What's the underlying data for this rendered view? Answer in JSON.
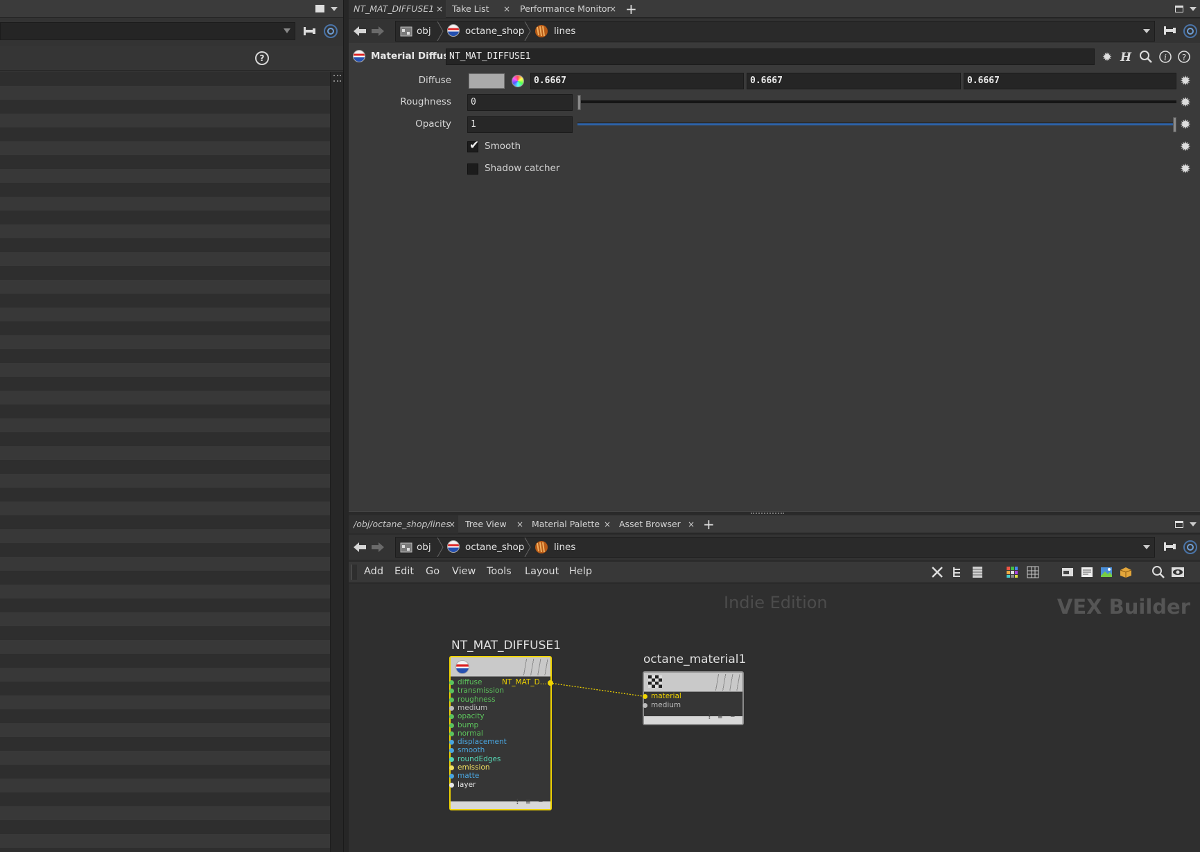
{
  "left_pane": {
    "help_label": "?"
  },
  "top_tabs": [
    {
      "label": "NT_MAT_DIFFUSE1",
      "active": true
    },
    {
      "label": "Take List",
      "active": false
    },
    {
      "label": "Performance Monitor",
      "active": false
    }
  ],
  "close_glyph": "×",
  "add_tab_glyph": "+",
  "top_path": {
    "crumbs": [
      "obj",
      "octane_shop",
      "lines"
    ]
  },
  "parameters": {
    "node_type": "Material Diffuse",
    "node_name": "NT_MAT_DIFFUSE1",
    "diffuse": {
      "label": "Diffuse",
      "swatch_color": "#aaaaaa",
      "values": [
        "0.6667",
        "0.6667",
        "0.6667"
      ]
    },
    "roughness": {
      "label": "Roughness",
      "value": "0",
      "slider_fraction": 0.0
    },
    "opacity": {
      "label": "Opacity",
      "value": "1",
      "slider_fraction": 1.0
    },
    "smooth": {
      "label": "Smooth",
      "checked": true
    },
    "shadow_catcher": {
      "label": "Shadow catcher",
      "checked": false
    },
    "checkmark_glyph": "✔",
    "gear_glyph": "✹"
  },
  "bottom_tabs": [
    {
      "label": "/obj/octane_shop/lines",
      "active": true
    },
    {
      "label": "Tree View",
      "active": false
    },
    {
      "label": "Material Palette",
      "active": false
    },
    {
      "label": "Asset Browser",
      "active": false
    }
  ],
  "bottom_path": {
    "crumbs": [
      "obj",
      "octane_shop",
      "lines"
    ]
  },
  "network_menu": [
    "Add",
    "Edit",
    "Go",
    "View",
    "Tools",
    "Layout",
    "Help"
  ],
  "network": {
    "watermark": "Indie Edition",
    "context_label": "VEX Builder",
    "nodes": {
      "diffuse": {
        "title": "NT_MAT_DIFFUSE1",
        "output_label": "NT_MAT_D...",
        "inputs": [
          {
            "name": "diffuse",
            "color": "#5cc35c"
          },
          {
            "name": "transmission",
            "color": "#5cc35c"
          },
          {
            "name": "roughness",
            "color": "#5cc35c"
          },
          {
            "name": "medium",
            "color": "#bdbdbd"
          },
          {
            "name": "opacity",
            "color": "#5cc35c"
          },
          {
            "name": "bump",
            "color": "#5cc35c"
          },
          {
            "name": "normal",
            "color": "#5cc35c"
          },
          {
            "name": "displacement",
            "color": "#4aa6e0"
          },
          {
            "name": "smooth",
            "color": "#4aa6e0"
          },
          {
            "name": "roundEdges",
            "color": "#56d6b4"
          },
          {
            "name": "emission",
            "color": "#f0e060"
          },
          {
            "name": "matte",
            "color": "#4aa6e0"
          },
          {
            "name": "layer",
            "color": "#e8e8e8"
          }
        ]
      },
      "material": {
        "title": "octane_material1",
        "inputs": [
          {
            "name": "material",
            "color": "#f0d400"
          },
          {
            "name": "medium",
            "color": "#bdbdbd"
          }
        ]
      }
    },
    "wire_color": "#f0d400"
  },
  "colors": {
    "selected_node": "#f0d400",
    "slider_fill": "#2e63a8",
    "focus_ring": "#4a74a8"
  }
}
